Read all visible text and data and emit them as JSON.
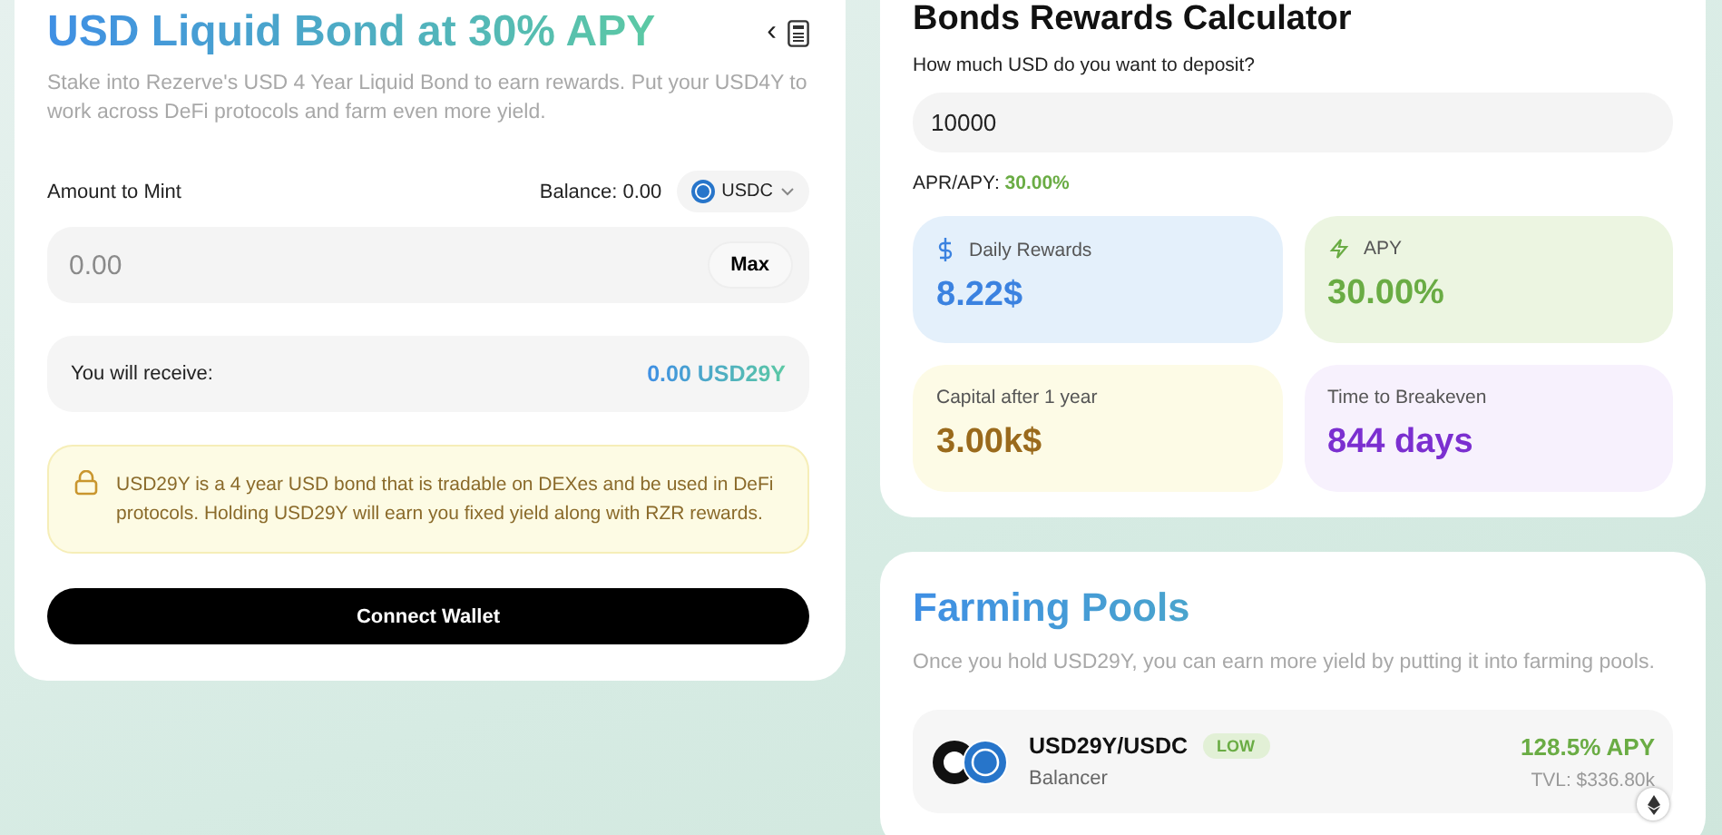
{
  "bond": {
    "title": "USD Liquid Bond at 30% APY",
    "back_icon": "‹",
    "description": "Stake into Rezerve's USD 4 Year Liquid Bond to earn rewards. Put your USD4Y to work across DeFi protocols and farm even more yield.",
    "amount_label": "Amount to Mint",
    "balance": "Balance: 0.00",
    "token": "USDC",
    "amount": {
      "placeholder": "0.00"
    },
    "max_button": "Max",
    "receive_label": "You will receive:",
    "receive_value": "0.00 USD29Y",
    "notice": "USD29Y is a 4 year USD bond that is tradable on DEXes and be used in DeFi protocols. Holding USD29Y will earn you fixed yield along with RZR rewards.",
    "connect_button": "Connect Wallet"
  },
  "calculator": {
    "title": "Bonds Rewards Calculator",
    "question": "How much USD do you want to deposit?",
    "deposit": {
      "value": "10000"
    },
    "apr_label": "APR/APY:",
    "apr_value": "30.00%",
    "stats": [
      {
        "kind": "dollar",
        "label": "Daily Rewards",
        "value": "8.22$",
        "color": "#3b82e0"
      },
      {
        "kind": "bolt",
        "label": "APY",
        "value": "30.00%",
        "color": "#6aac44"
      },
      {
        "kind": "plain",
        "label": "Capital after 1 year",
        "value": "3.00k$",
        "color": "#9a6a1c"
      },
      {
        "kind": "plain",
        "label": "Time to Breakeven",
        "value": "844 days",
        "color": "#7b2fd0"
      }
    ]
  },
  "farming": {
    "title": "Farming Pools",
    "description": "Once you hold USD29Y, you can earn more yield by putting it into farming pools.",
    "pools": [
      {
        "name": "USD29Y/USDC",
        "risk": "LOW",
        "protocol": "Balancer",
        "apy": "128.5% APY",
        "tvl": "TVL: $336.80k"
      }
    ]
  }
}
